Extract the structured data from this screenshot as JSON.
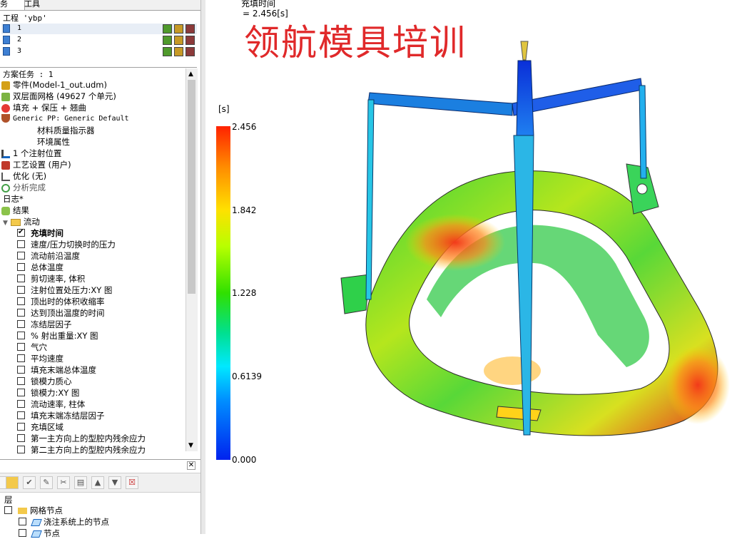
{
  "tabs": [
    "务",
    "工具"
  ],
  "project": {
    "title": "工程 'ybp'",
    "studies": [
      "1",
      "2",
      "3"
    ]
  },
  "tasks": {
    "header": "方案任务 : 1",
    "items": [
      {
        "label": "零件(Model-1_out.udm)",
        "icon": "part-icon"
      },
      {
        "label": "双层面网格 (49627 个单元)",
        "icon": "mesh-icon"
      },
      {
        "label": "填充 + 保压 + 翘曲",
        "icon": "analysis-sequence-icon"
      },
      {
        "label": "Generic PP: Generic Default",
        "icon": "material-icon"
      },
      {
        "label": "材料质量指示器",
        "icon": ""
      },
      {
        "label": "环境属性",
        "icon": ""
      },
      {
        "label": "1 个注射位置",
        "icon": "injection-icon"
      },
      {
        "label": "工艺设置 (用户)",
        "icon": "process-settings-icon"
      },
      {
        "label": "优化 (无)",
        "icon": "optimization-icon"
      },
      {
        "label": "分析完成",
        "icon": "analysis-complete-icon"
      }
    ],
    "log": "日志*",
    "results": "结果",
    "flow": "流动",
    "result_items": [
      {
        "label": "充填时间",
        "checked": true
      },
      {
        "label": "速度/压力切换时的压力",
        "checked": false
      },
      {
        "label": "流动前沿温度",
        "checked": false
      },
      {
        "label": "总体温度",
        "checked": false
      },
      {
        "label": "剪切速率, 体积",
        "checked": false
      },
      {
        "label": "注射位置处压力:XY 图",
        "checked": false
      },
      {
        "label": "顶出时的体积收缩率",
        "checked": false
      },
      {
        "label": "达到顶出温度的时间",
        "checked": false
      },
      {
        "label": "冻结层因子",
        "checked": false
      },
      {
        "label": "% 射出重量:XY 图",
        "checked": false
      },
      {
        "label": "气穴",
        "checked": false
      },
      {
        "label": "平均速度",
        "checked": false
      },
      {
        "label": "填充末端总体温度",
        "checked": false
      },
      {
        "label": "锁模力质心",
        "checked": false
      },
      {
        "label": "锁模力:XY 图",
        "checked": false
      },
      {
        "label": "流动速率, 柱体",
        "checked": false
      },
      {
        "label": "填充末端冻结层因子",
        "checked": false
      },
      {
        "label": "充填区域",
        "checked": false
      },
      {
        "label": "第一主方向上的型腔内残余应力",
        "checked": false
      },
      {
        "label": "第二主方向上的型腔内残余应力",
        "checked": false
      }
    ]
  },
  "layers": {
    "header": "层",
    "items": [
      "网格节点",
      "浇注系统上的节点",
      "节点"
    ]
  },
  "result": {
    "title": "充填时间",
    "value": "= 2.456[s]",
    "watermark": "领航模具培训",
    "unit": "[s]",
    "legend_ticks": [
      "2.456",
      "1.842",
      "1.228",
      "0.6139",
      "0.000"
    ],
    "legend_max": 2.456,
    "legend_min": 0.0
  }
}
